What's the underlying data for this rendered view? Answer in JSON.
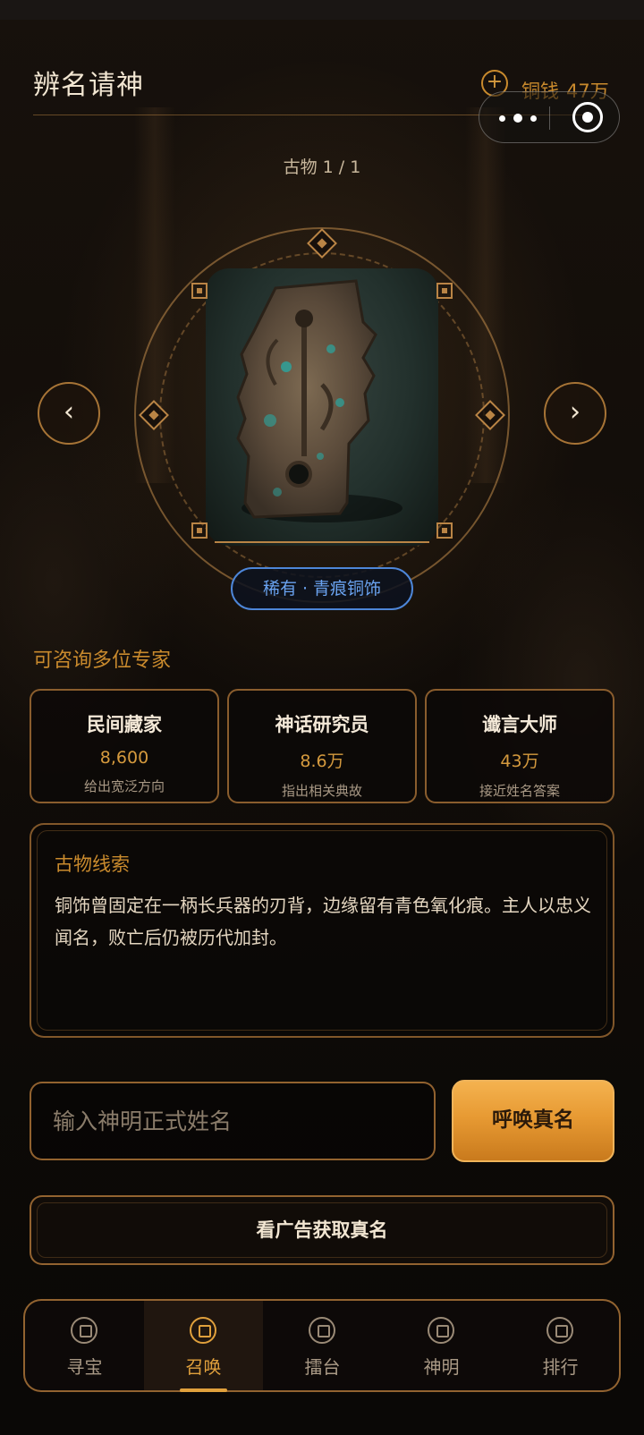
{
  "header": {
    "title": "辨名请神",
    "coins_label": "铜钱",
    "coins_value": "47万",
    "add_symbol": "+"
  },
  "relic": {
    "counter": "古物 1 / 1",
    "rarity_tag": "稀有 · 青痕铜饰"
  },
  "navigation": {
    "prev_symbol": "‹",
    "next_symbol": "›"
  },
  "experts": {
    "title": "可咨询多位专家",
    "items": [
      {
        "name": "民间藏家",
        "price": "8,600",
        "desc": "给出宽泛方向"
      },
      {
        "name": "神话研究员",
        "price": "8.6万",
        "desc": "指出相关典故"
      },
      {
        "name": "谶言大师",
        "price": "43万",
        "desc": "接近姓名答案"
      }
    ]
  },
  "clue": {
    "title": "古物线索",
    "text": "铜饰曾固定在一柄长兵器的刃背，边缘留有青色氧化痕。主人以忠义闻名，败亡后仍被历代加封。"
  },
  "answer": {
    "placeholder": "输入神明正式姓名",
    "value": "",
    "summon_label": "呼唤真名"
  },
  "ad": {
    "label": "看广告获取真名"
  },
  "tabbar": {
    "active_index": 1,
    "items": [
      {
        "label": "寻宝",
        "icon": "home-icon"
      },
      {
        "label": "召唤",
        "icon": "summon-icon"
      },
      {
        "label": "擂台",
        "icon": "arena-icon"
      },
      {
        "label": "神明",
        "icon": "deity-icon"
      },
      {
        "label": "排行",
        "icon": "ranking-icon"
      }
    ]
  },
  "colors": {
    "accent": "#c98a2d",
    "rarity_blue": "#4d86d8",
    "button_gold": "#e79a33"
  }
}
